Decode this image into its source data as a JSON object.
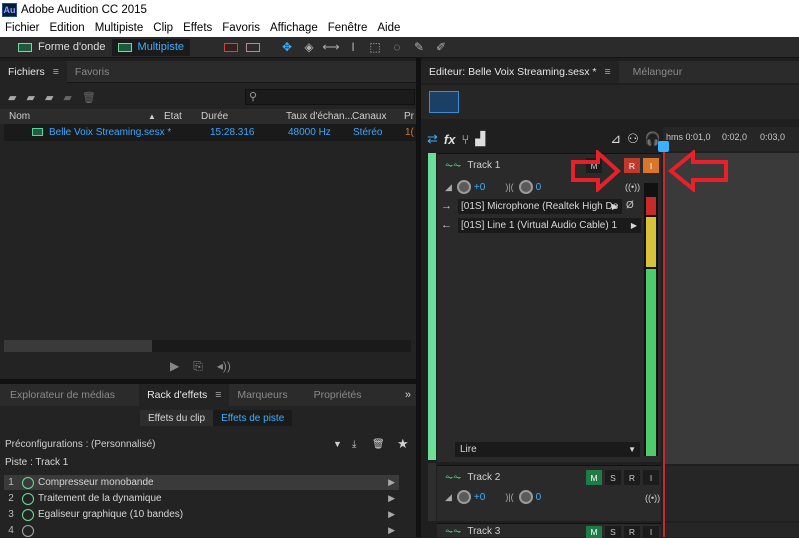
{
  "app": {
    "title": "Adobe Audition CC 2015",
    "logo": "Au"
  },
  "menu": [
    "Fichier",
    "Edition",
    "Multipiste",
    "Clip",
    "Effets",
    "Favoris",
    "Affichage",
    "Fenêtre",
    "Aide"
  ],
  "toolbar": {
    "waveform_label": "Forme d'onde",
    "multitrack_label": "Multipiste"
  },
  "files_panel": {
    "tabs": [
      "Fichiers",
      "Favoris"
    ],
    "search_placeholder": "",
    "columns": [
      "Nom",
      "Etat",
      "Durée",
      "Taux d'échan...",
      "Canaux",
      "Pr"
    ],
    "rows": [
      {
        "name": "Belle Voix Streaming.sesx *",
        "state": "",
        "duration": "15:28.316",
        "rate": "48000 Hz",
        "channels": "Stéréo",
        "extra": "1("
      }
    ]
  },
  "bottom_panel": {
    "tabs": [
      "Explorateur de médias",
      "Rack d'effets",
      "Marqueurs",
      "Propriétés"
    ],
    "subtabs": [
      "Effets du clip",
      "Effets de piste"
    ],
    "preset_label": "Préconfigurations :",
    "preset_value": "(Personnalisé)",
    "track_label": "Piste : Track 1",
    "effects": [
      {
        "num": "1",
        "name": "Compresseur monobande"
      },
      {
        "num": "2",
        "name": "Traitement de la dynamique"
      },
      {
        "num": "3",
        "name": "Egaliseur graphique (10 bandes)"
      },
      {
        "num": "4",
        "name": ""
      }
    ]
  },
  "editor": {
    "tabs": [
      "Editeur: Belle Voix Streaming.sesx *",
      "Mélangeur"
    ],
    "ruler_labels": [
      "hms 0:01,0",
      "0:02,0",
      "0:03,0"
    ],
    "tracks": [
      {
        "name": "Track 1",
        "vol": "+0",
        "pan": "0",
        "input": "[01S] Microphone (Realtek High De",
        "output": "[01S] Line 1 (Virtual Audio Cable) 1",
        "mode": "Lire"
      },
      {
        "name": "Track 2",
        "vol": "+0",
        "pan": "0"
      },
      {
        "name": "Track 3"
      }
    ],
    "btn_m": "M",
    "btn_s": "S",
    "btn_r": "R",
    "btn_i": "I"
  },
  "colors": {
    "accent": "#3ab0ff",
    "green": "#6adf9a",
    "record": "#c0392b",
    "annotation": "#e8202a"
  }
}
